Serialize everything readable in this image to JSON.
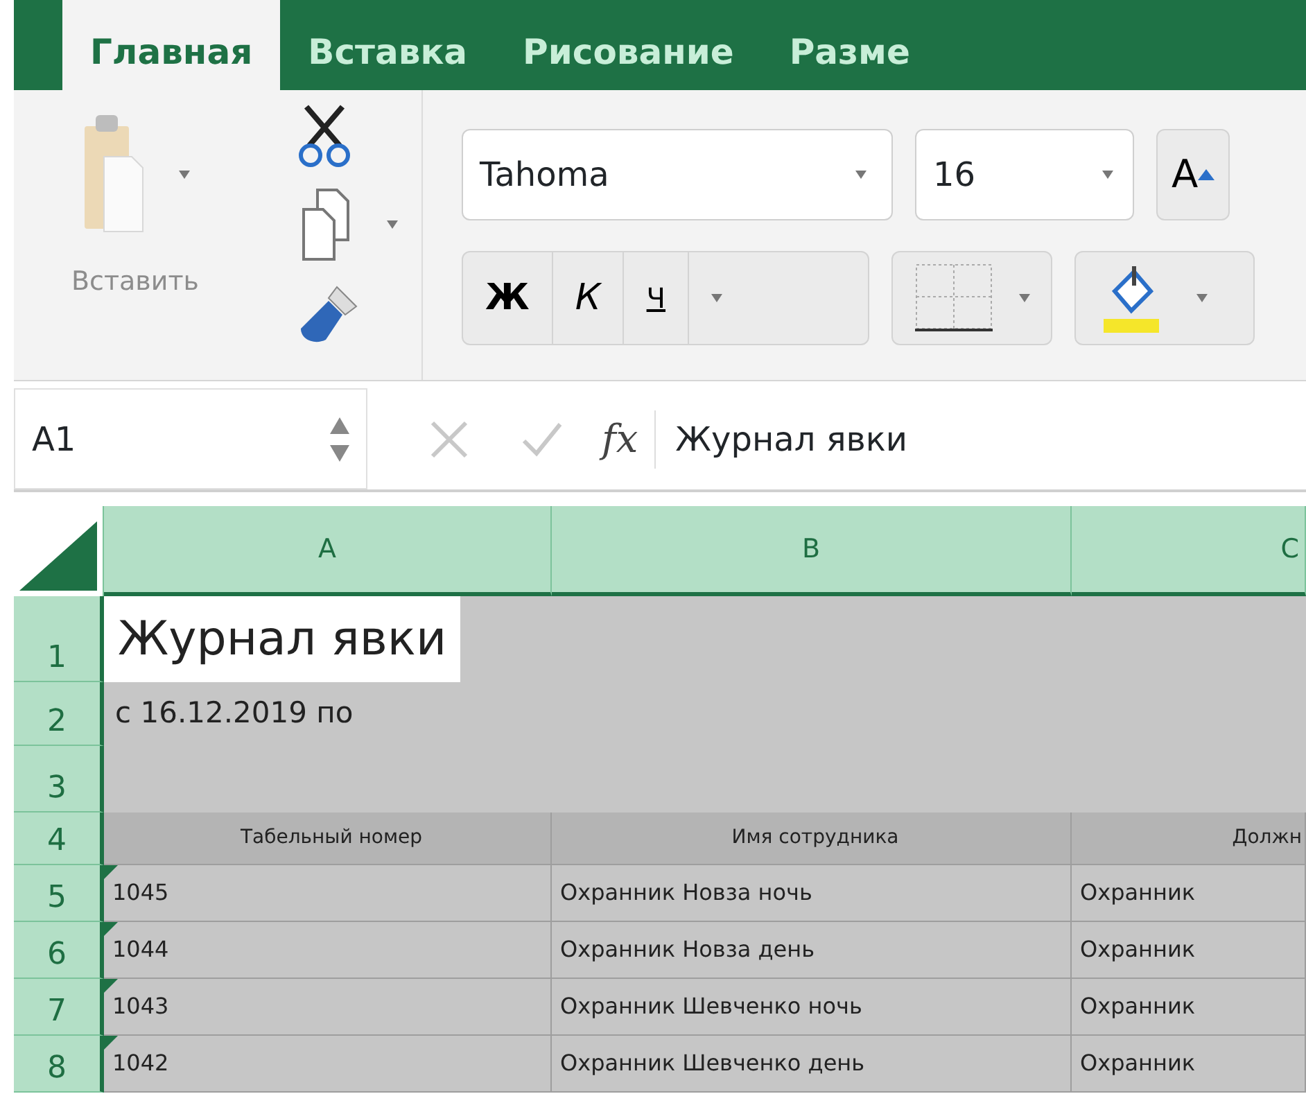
{
  "ribbon": {
    "tabs": [
      {
        "label": "Главная",
        "selected": true
      },
      {
        "label": "Вставка",
        "selected": false
      },
      {
        "label": "Рисование",
        "selected": false
      },
      {
        "label": "Разме",
        "selected": false
      }
    ]
  },
  "toolbar": {
    "paste_label": "Вставить",
    "font_name": "Tahoma",
    "font_size": "16",
    "grow_label": "A",
    "bold_label": "Ж",
    "italic_label": "К",
    "underline_label": "Ч"
  },
  "formula_bar": {
    "name_box": "A1",
    "fx_label": "fx",
    "formula": "Журнал явки"
  },
  "sheet": {
    "columns": [
      {
        "label": "A",
        "selected": true
      },
      {
        "label": "B",
        "selected": true
      },
      {
        "label": "C",
        "selected": true
      }
    ],
    "rows": [
      {
        "number": "1",
        "selected": true,
        "kind": "title",
        "cells": [
          "Журнал явки"
        ]
      },
      {
        "number": "2",
        "selected": true,
        "kind": "subtitle",
        "cells": [
          "с 16.12.2019 по"
        ]
      },
      {
        "number": "3",
        "selected": true,
        "kind": "blank",
        "cells": []
      },
      {
        "number": "4",
        "selected": true,
        "kind": "header",
        "cells": [
          "Табельный номер",
          "Имя сотрудника",
          "Должн"
        ]
      },
      {
        "number": "5",
        "selected": true,
        "kind": "data",
        "flagged": true,
        "cells": [
          "1045",
          "Охранник Новза ночь",
          "Охранник"
        ]
      },
      {
        "number": "6",
        "selected": true,
        "kind": "data",
        "flagged": true,
        "cells": [
          "1044",
          "Охранник Новза день",
          "Охранник"
        ]
      },
      {
        "number": "7",
        "selected": true,
        "kind": "data",
        "flagged": true,
        "cells": [
          "1043",
          "Охранник Шевченко ночь",
          "Охранник"
        ]
      },
      {
        "number": "8",
        "selected": true,
        "kind": "data",
        "flagged": true,
        "cells": [
          "1042",
          "Охранник Шевченко день",
          "Охранник"
        ]
      }
    ]
  }
}
